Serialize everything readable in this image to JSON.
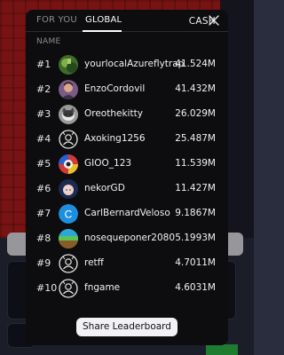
{
  "tabs": [
    {
      "label": "FOR YOU",
      "active": false
    },
    {
      "label": "GLOBAL",
      "active": true
    }
  ],
  "columns": {
    "name": "NAME",
    "cash": "CASH"
  },
  "rows": [
    {
      "rank": "#1",
      "name": "yourlocalAzureflytrap",
      "cash": "41.524M",
      "avatar": "photo-green-icon"
    },
    {
      "rank": "#2",
      "name": "EnzoCordovil",
      "cash": "41.432M",
      "avatar": "photo-person-icon"
    },
    {
      "rank": "#3",
      "name": "Oreothekitty",
      "cash": "26.029M",
      "avatar": "photo-cat-icon"
    },
    {
      "rank": "#4",
      "name": "Axoking1256",
      "cash": "25.487M",
      "avatar": "default-avatar-icon"
    },
    {
      "rank": "#5",
      "name": "GIOO_123",
      "cash": "11.539M",
      "avatar": "photo-colorful-icon"
    },
    {
      "rank": "#6",
      "name": "nekorGD",
      "cash": "11.427M",
      "avatar": "photo-anime-icon"
    },
    {
      "rank": "#7",
      "name": "CarlBernardVeloso",
      "cash": "9.1867M",
      "avatar": "letter-c-avatar-icon"
    },
    {
      "rank": "#8",
      "name": "noseque­poner2080",
      "cash": "5.1993M",
      "avatar": "landscape-avatar-icon"
    },
    {
      "rank": "#9",
      "name": "retff",
      "cash": "4.7011M",
      "avatar": "default-avatar-icon"
    },
    {
      "rank": "#10",
      "name": "fngame",
      "cash": "4.6031M",
      "avatar": "default-avatar-icon"
    }
  ],
  "share_label": "Share Leaderboard",
  "colors": {
    "modal_bg": "#0d0d0f",
    "letter_avatar": "#1e8fe0"
  }
}
